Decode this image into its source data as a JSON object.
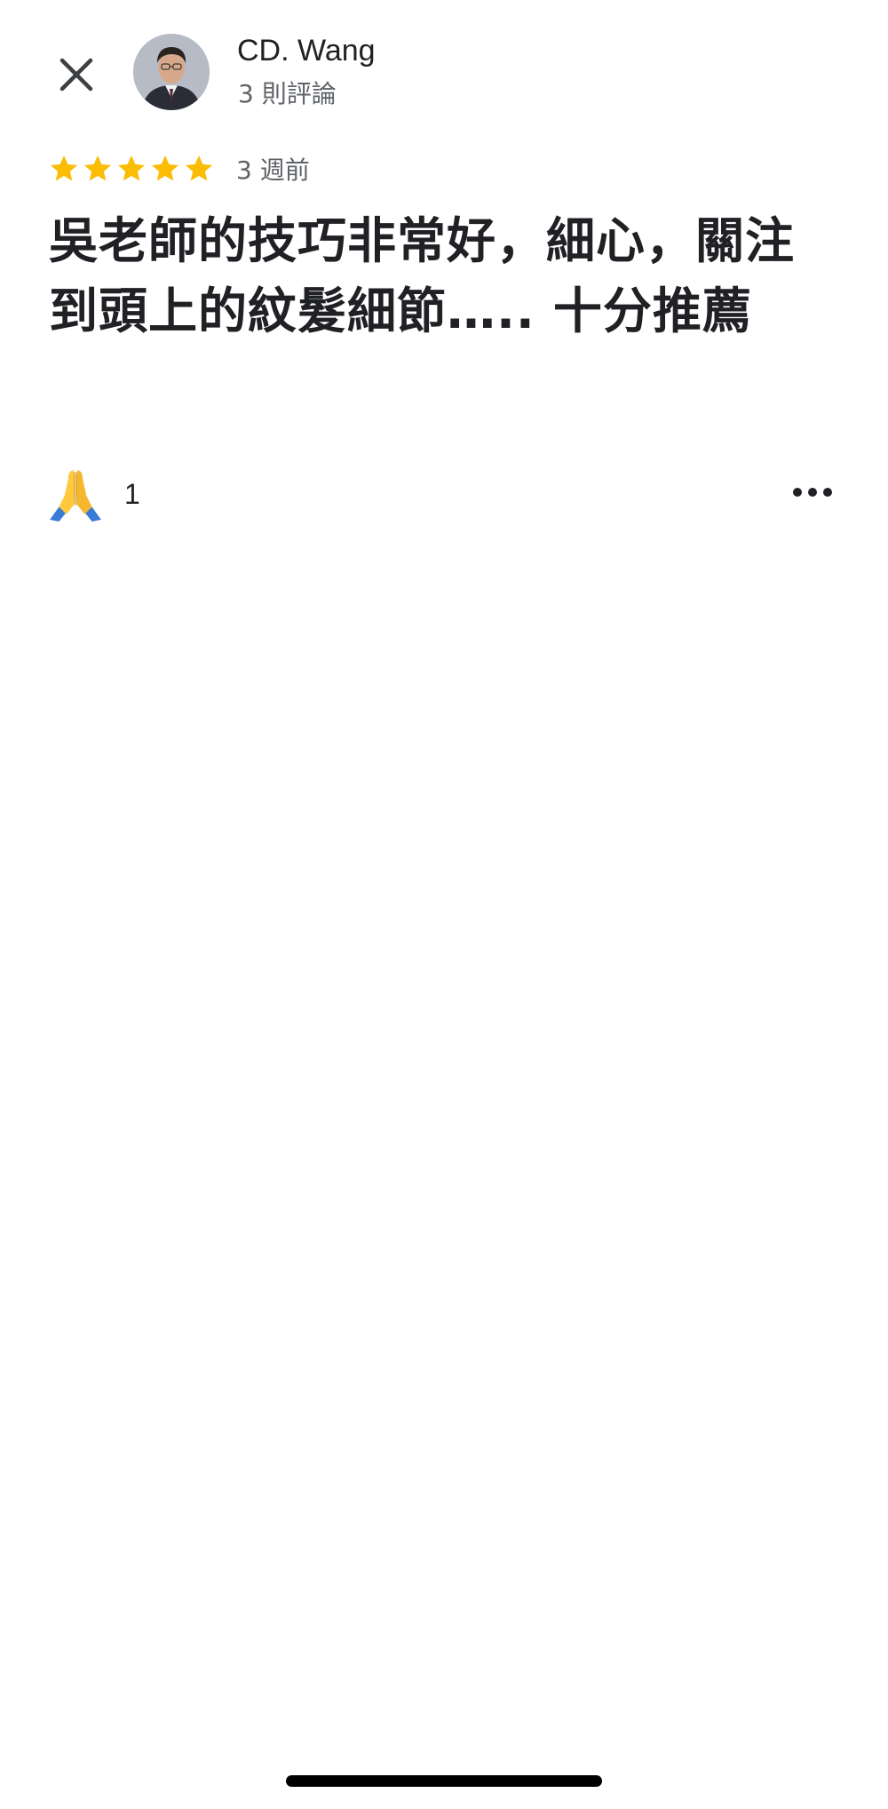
{
  "reviewer": {
    "name": "CD. Wang",
    "review_count": "3 則評論"
  },
  "review": {
    "rating": 5,
    "max_rating": 5,
    "time_ago": "3 週前",
    "text": "吳老師的技巧非常好，細心，關注到頭上的紋髮細節….. 十分推薦"
  },
  "reaction": {
    "icon": "folded-hands-icon",
    "count": "1"
  },
  "icons": {
    "close": "close-icon",
    "more": "more-options-icon",
    "star": "star-icon"
  },
  "colors": {
    "star": "#FBBC04",
    "text_primary": "#202124",
    "text_secondary": "#5F6368"
  }
}
